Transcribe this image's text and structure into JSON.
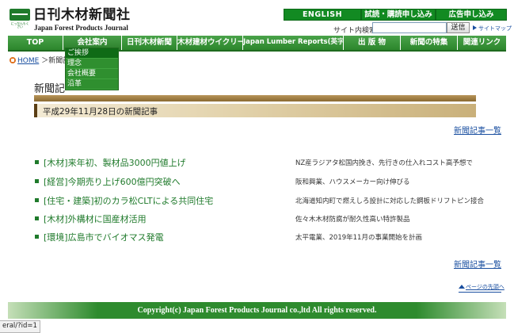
{
  "header": {
    "logo_jp": "日刊木材新聞社",
    "logo_en": "Japan Forest Products Journal",
    "logo_mark_caption": "にっかんもくざい",
    "buttons": {
      "english": "ENGLISH",
      "trial": "試読・購読申し込み",
      "ad": "広告申し込み"
    },
    "search": {
      "label": "サイト内検索",
      "value": "",
      "button": "送信"
    },
    "sitemap": "サイトマップ"
  },
  "nav": {
    "items": [
      "TOP",
      "会社案内",
      "日刊木材新聞",
      "木材建材ウイクリー",
      "Japan Lumber Reports(英字紙)",
      "出 版 物",
      "新聞の特集",
      "関連リンク"
    ],
    "dropdown": [
      "ご挨拶",
      "理念",
      "会社概要",
      "沿革"
    ]
  },
  "breadcrumb": {
    "home": "HOME",
    "current": "＞新聞記"
  },
  "page": {
    "heading": "新聞記",
    "date_heading": "平成29年11月28日の新聞記事",
    "list_link": "新聞記事一覧"
  },
  "articles": [
    {
      "title": "[木材]来年初、製材品3000円値上げ",
      "summary": "NZ産ラジアタ松国内挽き、先行きの仕入れコスト高予想で"
    },
    {
      "title": "[経営]今期売り上げ600億円突破へ",
      "summary": "阪和興業、ハウスメーカー向け伸びる"
    },
    {
      "title": "[住宅・建築]初のカラ松CLTによる共同住宅",
      "summary": "北海道知内町で燃えしろ設計に対応した鋼板ドリフトピン接合"
    },
    {
      "title": "[木材]外構材に国産材活用",
      "summary": "佐々木木材防腐が耐久性高い特許製品"
    },
    {
      "title": "[環境]広島市でバイオマス発電",
      "summary": "太平電業、2019年11月の事業開始を計画"
    }
  ],
  "footer": {
    "page_top": "ページの先頭へ",
    "copyright": "Copyright(c) Japan Forest Products Journal co.,ltd All rights reserved."
  },
  "status_bar": {
    "url": "eral/?id=1"
  },
  "colors": {
    "brand_green": "#2e8b2e",
    "button_green": "#128a22",
    "link_blue": "#1a4fa0",
    "headline_green": "#1f7a2b"
  }
}
